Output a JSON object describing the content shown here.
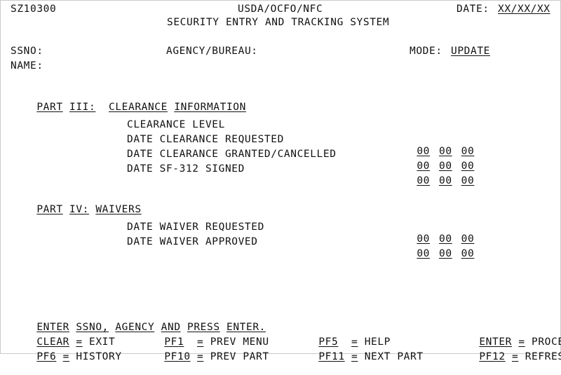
{
  "screen": {
    "program_id": "SZ10300",
    "org": "USDA/OCFO/NFC",
    "title": "SECURITY ENTRY AND TRACKING SYSTEM",
    "date_label": "DATE:",
    "date_value": "XX/XX/XX"
  },
  "identity": {
    "ssno_label": "SSNO:",
    "ssno_value": "",
    "name_label": "NAME:",
    "name_value": "",
    "agency_label": "AGENCY/BUREAU:",
    "agency_value": "",
    "mode_label": "MODE:",
    "mode_value": "UPDATE"
  },
  "part3": {
    "heading_words": [
      "PART",
      "III:",
      "CLEARANCE",
      "INFORMATION"
    ],
    "rows": [
      {
        "label": "CLEARANCE LEVEL",
        "has_date": false,
        "date": [
          "",
          "",
          ""
        ]
      },
      {
        "label": "DATE CLEARANCE REQUESTED",
        "has_date": true,
        "date": [
          "00",
          "00",
          "00"
        ]
      },
      {
        "label": "DATE CLEARANCE GRANTED/CANCELLED",
        "has_date": true,
        "date": [
          "00",
          "00",
          "00"
        ]
      },
      {
        "label": "DATE SF-312 SIGNED",
        "has_date": true,
        "date": [
          "00",
          "00",
          "00"
        ]
      }
    ]
  },
  "part4": {
    "heading_words": [
      "PART",
      "IV:",
      "WAIVERS"
    ],
    "rows": [
      {
        "label": "DATE WAIVER REQUESTED",
        "has_date": true,
        "date": [
          "00",
          "00",
          "00"
        ]
      },
      {
        "label": "DATE WAIVER APPROVED",
        "has_date": true,
        "date": [
          "00",
          "00",
          "00"
        ]
      }
    ]
  },
  "footer": {
    "instruction_words": [
      "ENTER",
      "SSNO,",
      "AGENCY",
      "AND",
      "PRESS",
      "ENTER."
    ],
    "keys": [
      {
        "key": "CLEAR",
        "sep": "=",
        "action": "EXIT"
      },
      {
        "key": "PF1",
        "sep": "=",
        "action": "PREV MENU"
      },
      {
        "key": "PF5",
        "sep": "=",
        "action": "HELP"
      },
      {
        "key": "ENTER",
        "sep": "=",
        "action": "PROCESS"
      },
      {
        "key": "PF6",
        "sep": "=",
        "action": "HISTORY"
      },
      {
        "key": "PF10",
        "sep": "=",
        "action": "PREV PART"
      },
      {
        "key": "PF11",
        "sep": "=",
        "action": "NEXT PART"
      },
      {
        "key": "PF12",
        "sep": "=",
        "action": "REFRESH"
      }
    ]
  },
  "colors": {
    "text": "#111111",
    "background": "#ffffff",
    "border": "#c9c9c9"
  }
}
